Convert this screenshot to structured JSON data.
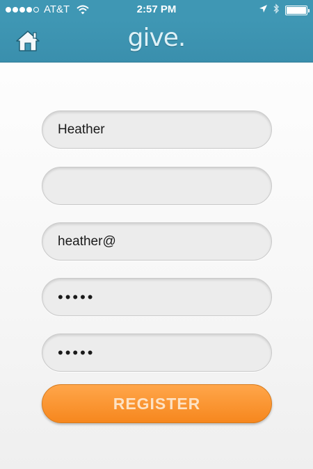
{
  "status_bar": {
    "carrier": "AT&T",
    "time": "2:57 PM",
    "signal_bars_filled": 4,
    "signal_bars_total": 5,
    "battery_level": 1.0,
    "icons": [
      "signal-icon",
      "wifi-icon",
      "location-icon",
      "bluetooth-icon",
      "battery-icon"
    ]
  },
  "nav": {
    "logo": "give.",
    "home_icon": "home-icon"
  },
  "form": {
    "fields": [
      {
        "value": "Heather",
        "type": "text"
      },
      {
        "value": "",
        "type": "text"
      },
      {
        "value": "heather@",
        "type": "email"
      },
      {
        "value": "•••••",
        "type": "password"
      },
      {
        "value": "•••••",
        "type": "password"
      }
    ],
    "register_label": "REGISTER"
  },
  "colors": {
    "header": "#3f97b4",
    "button_orange": "#f6871e",
    "field_bg": "#ececec"
  }
}
